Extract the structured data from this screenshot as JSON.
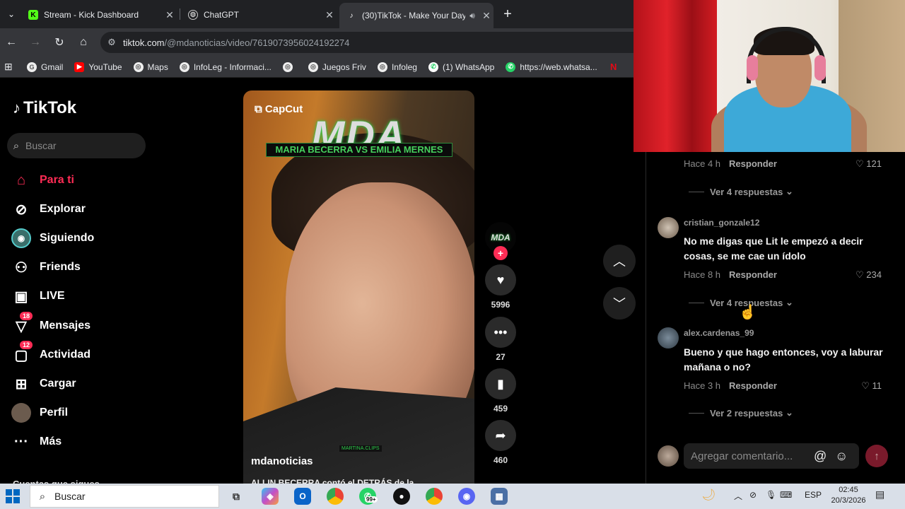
{
  "browser": {
    "tabs": [
      {
        "title": "Stream - Kick Dashboard",
        "icon": "kick-icon"
      },
      {
        "title": "ChatGPT",
        "icon": "chatgpt-icon"
      },
      {
        "title": "(30)TikTok - Make Your Day",
        "icon": "tiktok-icon"
      }
    ],
    "new_tab": "+",
    "url_host": "tiktok.com",
    "url_path": "/@mdanoticias/video/7619073956024192274",
    "bookmarks": [
      "Gmail",
      "YouTube",
      "Maps",
      "InfoLeg - Informaci...",
      "Juegos Friv",
      "Infoleg",
      "(1) WhatsApp",
      "https://web.whatsa..."
    ]
  },
  "tiktok": {
    "logo": "TikTok",
    "search_placeholder": "Buscar",
    "nav": [
      {
        "label": "Para ti",
        "icon": "home-icon",
        "active": true
      },
      {
        "label": "Explorar",
        "icon": "compass-icon"
      },
      {
        "label": "Siguiendo",
        "icon": "following-icon"
      },
      {
        "label": "Friends",
        "icon": "friends-icon"
      },
      {
        "label": "LIVE",
        "icon": "live-icon"
      },
      {
        "label": "Mensajes",
        "icon": "messages-icon",
        "badge": "18"
      },
      {
        "label": "Actividad",
        "icon": "activity-icon",
        "badge": "12"
      },
      {
        "label": "Cargar",
        "icon": "upload-icon"
      },
      {
        "label": "Perfil",
        "icon": "profile-icon"
      },
      {
        "label": "Más",
        "icon": "more-icon"
      }
    ],
    "following_header": "Cuentas que sigues"
  },
  "video": {
    "capcut": "CapCut",
    "overlay_title": "MDA",
    "overlay_subtitle": "MARIA BECERRA VS EMILIA MERNES",
    "watermark": "MARTINA.CLIPS",
    "author": "mdanoticias",
    "caption": "ALLIN BECERRA contó el DETRÁS de la..."
  },
  "actions": {
    "profile_label": "MDA",
    "likes": "5996",
    "comments": "27",
    "saves": "459",
    "shares": "460"
  },
  "comments": [
    {
      "time": "Hace 4 h",
      "reply": "Responder",
      "likes": "121",
      "more": "Ver 4 respuestas"
    },
    {
      "user": "cristian_gonzale12",
      "text": "No me digas que Lit le empezó a decir cosas, se me cae un ídolo",
      "time": "Hace 8 h",
      "reply": "Responder",
      "likes": "234",
      "more": "Ver 4 respuestas"
    },
    {
      "user": "alex.cardenas_99",
      "text": "Bueno y que hago entonces, voy a laburar mañana o no?",
      "time": "Hace 3 h",
      "reply": "Responder",
      "likes": "11",
      "more": "Ver 2 respuestas"
    }
  ],
  "comment_input_placeholder": "Agregar comentario...",
  "taskbar": {
    "search": "Buscar",
    "language": "ESP",
    "time": "02:45",
    "date": "20/3/2026",
    "whatsapp_badge": "99+"
  },
  "colors": {
    "accent": "#fe2c55",
    "background": "#000000",
    "chrome": "#35363a"
  }
}
